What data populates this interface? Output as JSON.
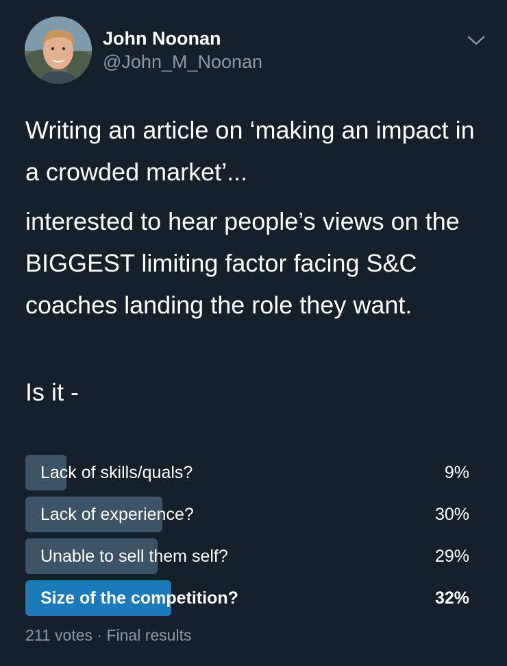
{
  "author": {
    "name": "John Noonan",
    "handle": "@John_M_Noonan"
  },
  "tweet": {
    "paragraphs": [
      "Writing an article on ‘making an impact in a crowded market’...",
      "interested to hear people’s views on the BIGGEST limiting factor facing S&C coaches landing the role they want.",
      "Is it -"
    ]
  },
  "poll": {
    "options": [
      {
        "label": "Lack of skills/quals?",
        "percent": 9,
        "percent_text": "9%",
        "winner": false
      },
      {
        "label": "Lack of experience?",
        "percent": 30,
        "percent_text": "30%",
        "winner": false
      },
      {
        "label": "Unable to sell them self?",
        "percent": 29,
        "percent_text": "29%",
        "winner": false
      },
      {
        "label": "Size of the competition?",
        "percent": 32,
        "percent_text": "32%",
        "winner": true
      }
    ],
    "votes": "211 votes",
    "separator": "·",
    "status": "Final results"
  },
  "icons": {
    "menu": "chevron-down-icon",
    "avatar": "profile-photo"
  },
  "colors": {
    "background": "#15202b",
    "bar": "#3d5466",
    "winner_bar": "#1b7ab8",
    "secondary_text": "#8899a6"
  }
}
